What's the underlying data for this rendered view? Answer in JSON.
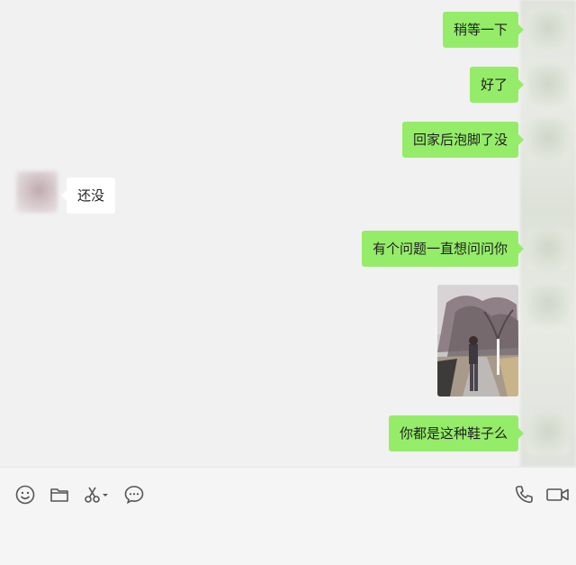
{
  "messages": [
    {
      "text": "稍等一下",
      "from": "me"
    },
    {
      "text": "好了",
      "from": "me"
    },
    {
      "text": "回家后泡脚了没",
      "from": "me"
    },
    {
      "text": "还没",
      "from": "other"
    },
    {
      "text": "有个问题一直想问问你",
      "from": "me"
    },
    {
      "type": "image",
      "from": "me",
      "icon": "photo-woman-trees"
    },
    {
      "text": "你都是这种鞋子么",
      "from": "me"
    }
  ],
  "toolbar": {
    "left_icons": [
      "emoji-icon",
      "folder-icon",
      "scissors-icon",
      "chat-history-icon"
    ],
    "right_icons": [
      "phone-icon",
      "video-icon"
    ]
  },
  "colors": {
    "me_bubble": "#95ec69",
    "other_bubble": "#ffffff",
    "background": "#f1f1f1"
  }
}
